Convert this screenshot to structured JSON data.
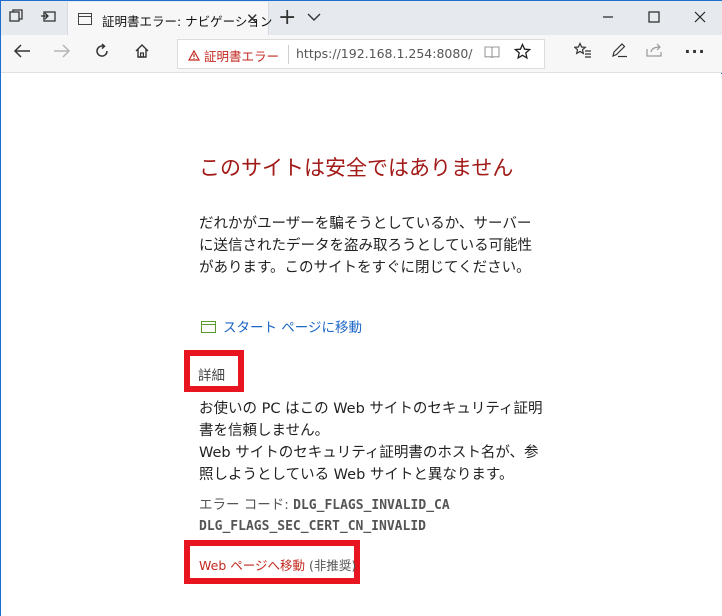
{
  "tab": {
    "title": "証明書エラー: ナビゲーション",
    "close": "✕"
  },
  "titlebar": {
    "new_tab": "+",
    "tab_menu": "⌵",
    "minimize": "—",
    "maximize": "☐",
    "close": "✕"
  },
  "toolbar": {
    "cert_error_label": "証明書エラー",
    "url": "https://192.168.1.254:8080/"
  },
  "icons": {
    "back": "arrow-left-icon",
    "forward": "arrow-right-icon",
    "refresh": "refresh-icon",
    "home": "home-icon",
    "warning": "warning-triangle-icon",
    "reading_view": "book-icon",
    "favorite": "star-icon",
    "favorites_hub": "star-list-icon",
    "notes": "pen-icon",
    "share": "share-icon"
  },
  "page": {
    "title": "このサイトは安全ではありません",
    "description": "だれかがユーザーを騙そうとしているか、サーバーに送信されたデータを盗み取ろうとしている可能性があります。このサイトをすぐに閉じてください。",
    "start_page_link": "スタート ページに移動",
    "details_label": "詳細",
    "details_line1": "お使いの PC はこの Web サイトのセキュリティ証明書を信頼しません。",
    "details_line2": "Web サイトのセキュリティ証明書のホスト名が、参照しようとしている Web サイトと異なります。",
    "error_code_label": "エラー コード:",
    "error_code_1": "DLG_FLAGS_INVALID_CA",
    "error_code_2": "DLG_FLAGS_SEC_CERT_CN_INVALID",
    "proceed_link": "Web ページへ移動",
    "proceed_note": "(非推奨)"
  },
  "colors": {
    "title_red": "#a21a17",
    "link_blue": "#1b66c6",
    "highlight_red": "#e8141f"
  }
}
